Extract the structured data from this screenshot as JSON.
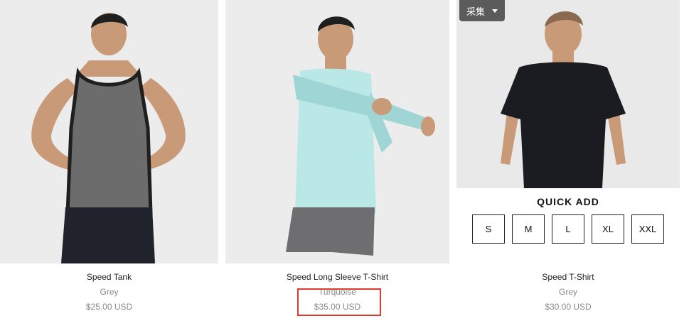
{
  "products": [
    {
      "name": "Speed Tank",
      "color": "Grey",
      "price": "$25.00 USD"
    },
    {
      "name": "Speed Long Sleeve T-Shirt",
      "color": "Turquoise",
      "price": "$35.00 USD"
    },
    {
      "name": "Speed T-Shirt",
      "color": "Grey",
      "price": "$30.00 USD"
    }
  ],
  "quick_add": {
    "title": "QUICK ADD",
    "sizes": [
      "S",
      "M",
      "L",
      "XL",
      "XXL"
    ]
  },
  "collect_button": {
    "label": "采集"
  },
  "colors": {
    "highlight": "#e0392f",
    "collect_bg": "#5b5b5b",
    "photo_bg": "#ececec"
  }
}
